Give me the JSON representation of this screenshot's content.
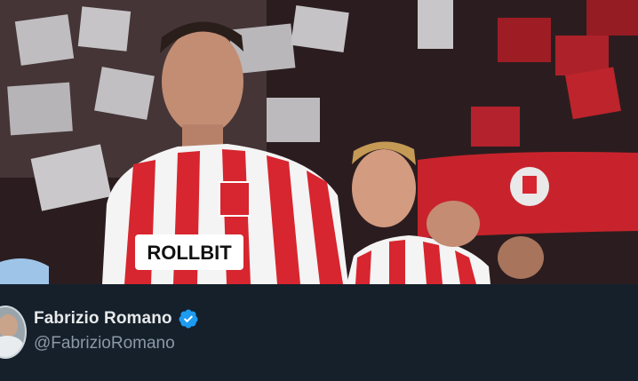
{
  "photo": {
    "description_icon": "football-photo-icon",
    "sponsor_text": "ROLLBIT",
    "accent_red": "#d7262f",
    "stripe_white": "#f4f4f4"
  },
  "author": {
    "display_name": "Fabrizio Romano",
    "handle": "@FabrizioRomano",
    "verified_icon": "verified-badge-icon",
    "verified_color": "#1d9bf0"
  }
}
